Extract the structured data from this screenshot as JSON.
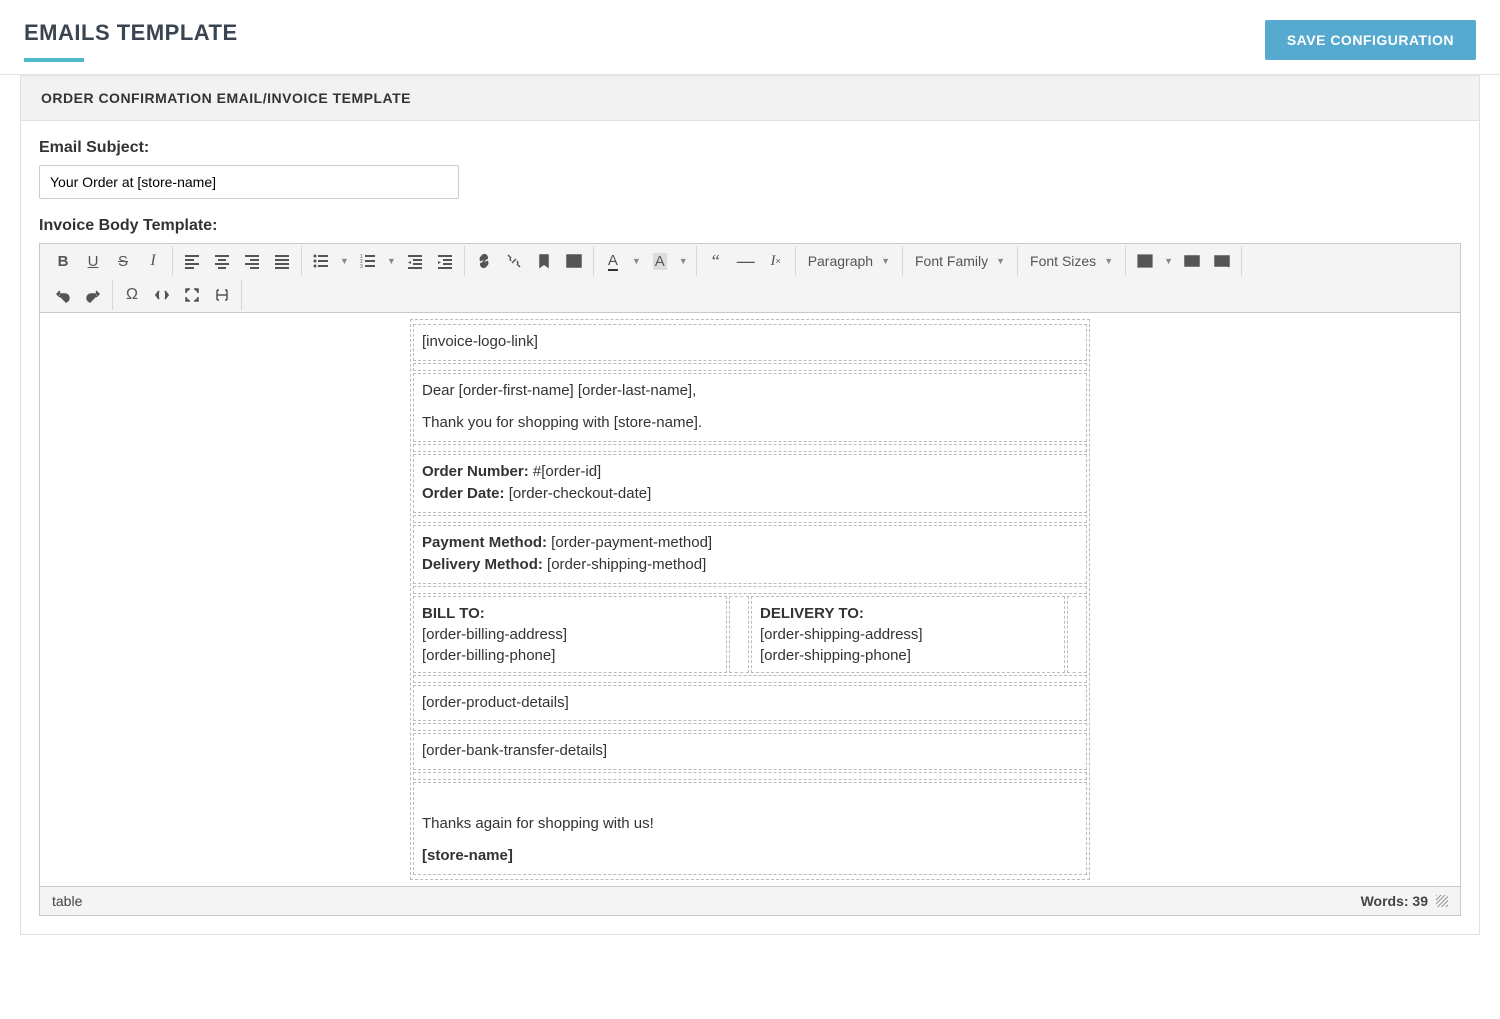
{
  "header": {
    "title": "EMAILS TEMPLATE",
    "save_button": "SAVE CONFIGURATION"
  },
  "panel": {
    "heading": "ORDER CONFIRMATION EMAIL/INVOICE TEMPLATE",
    "subject_label": "Email Subject:",
    "subject_value": "Your Order at [store-name]",
    "body_label": "Invoice Body Template:"
  },
  "toolbar": {
    "paragraph": "Paragraph",
    "font_family": "Font Family",
    "font_sizes": "Font Sizes"
  },
  "template": {
    "logo": "[invoice-logo-link]",
    "greeting": "Dear [order-first-name] [order-last-name],",
    "thanks1": "Thank you for shopping with [store-name].",
    "order_number_label": "Order Number:",
    "order_number_value": " #[order-id]",
    "order_date_label": "Order Date:",
    "order_date_value": " [order-checkout-date]",
    "payment_label": "Payment Method:",
    "payment_value": " [order-payment-method]",
    "delivery_label": "Delivery Method:",
    "delivery_value": " [order-shipping-method]",
    "bill_to": "BILL TO:",
    "bill_addr": "[order-billing-address]",
    "bill_phone": "[order-billing-phone]",
    "ship_to": "DELIVERY TO:",
    "ship_addr": "[order-shipping-address]",
    "ship_phone": "[order-shipping-phone]",
    "products": "[order-product-details]",
    "bank": "[order-bank-transfer-details]",
    "thanks2": "Thanks again for shopping with us!",
    "store": "[store-name]"
  },
  "statusbar": {
    "path": "table",
    "words_label": "Words: ",
    "words_count": "39"
  }
}
